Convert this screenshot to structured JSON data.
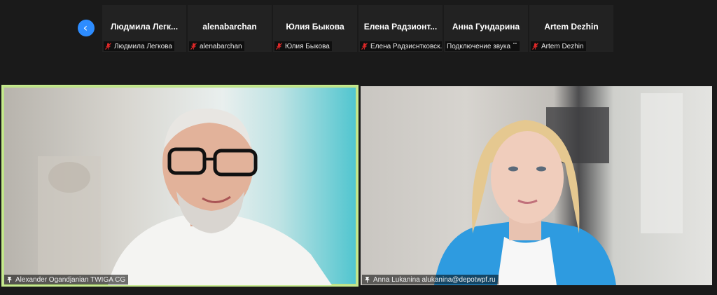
{
  "navigation": {
    "prev_icon": "chevron-left-icon"
  },
  "thumbnails": [
    {
      "display_name": "Людмила Легк...",
      "label": "Людмила Легкова",
      "muted": true
    },
    {
      "display_name": "alenabarchan",
      "label": "alenabarchan",
      "muted": true
    },
    {
      "display_name": "Юлия Быкова",
      "label": "Юлия Быкова",
      "muted": true
    },
    {
      "display_name": "Елена Радзионт...",
      "label": "Елена Радзиснтковск...",
      "muted": true
    },
    {
      "display_name": "Анна Гундарина",
      "label": "Подключение звука ⠉",
      "muted": false
    },
    {
      "display_name": "Artem Dezhin",
      "label": "Artem Dezhin",
      "muted": true
    }
  ],
  "main_videos": [
    {
      "label": "Alexander Ogandjanian TWIGA CG",
      "active_speaker": true
    },
    {
      "label": "Anna Lukanina alukanina@depotwpf.ru",
      "active_speaker": false
    }
  ],
  "colors": {
    "accent": "#2d8cff",
    "active_speaker_border": "#c6ea8e",
    "mute_red": "#e02828",
    "background": "#1a1a1a"
  }
}
